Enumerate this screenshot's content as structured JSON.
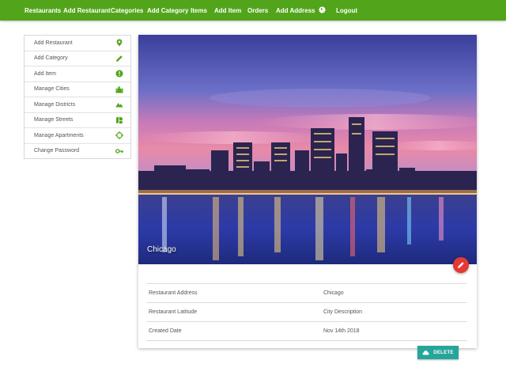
{
  "nav": {
    "items": [
      {
        "label": "Restaurants"
      },
      {
        "label": "Add Restaurant"
      },
      {
        "label": "Categories"
      },
      {
        "label": "Add Category"
      },
      {
        "label": "Items"
      },
      {
        "label": "Add Item"
      },
      {
        "label": "Orders"
      },
      {
        "label": "Add Address"
      },
      {
        "label": "Logout"
      }
    ],
    "globe_icon": "globe-icon",
    "background": "#52a51b"
  },
  "sidebar": {
    "items": [
      {
        "label": "Add Restaurant",
        "icon": "map-pin-icon"
      },
      {
        "label": "Add Category",
        "icon": "pencil-icon"
      },
      {
        "label": "Add Item",
        "icon": "info-circle-icon"
      },
      {
        "label": "Manage Cities",
        "icon": "city-icon"
      },
      {
        "label": "Manage Districts",
        "icon": "terrain-icon"
      },
      {
        "label": "Manage Streets",
        "icon": "map-icon"
      },
      {
        "label": "Manage Apartments",
        "icon": "crosshair-icon"
      },
      {
        "label": "Change Password",
        "icon": "key-icon"
      }
    ],
    "icon_color": "#52a51b"
  },
  "restaurant": {
    "caption": "Chicago",
    "details": [
      {
        "label": "Restaurant Address",
        "value": "Chicago"
      },
      {
        "label": "Restaurant Latitude",
        "value": "City Description"
      },
      {
        "label": "Created Date",
        "value": "Nov 14th 2018"
      }
    ]
  },
  "actions": {
    "edit_icon": "pencil-icon",
    "edit_color": "#e53935",
    "delete_label": "DELETE",
    "delete_icon": "cloud-icon",
    "delete_color": "#26a69a"
  }
}
